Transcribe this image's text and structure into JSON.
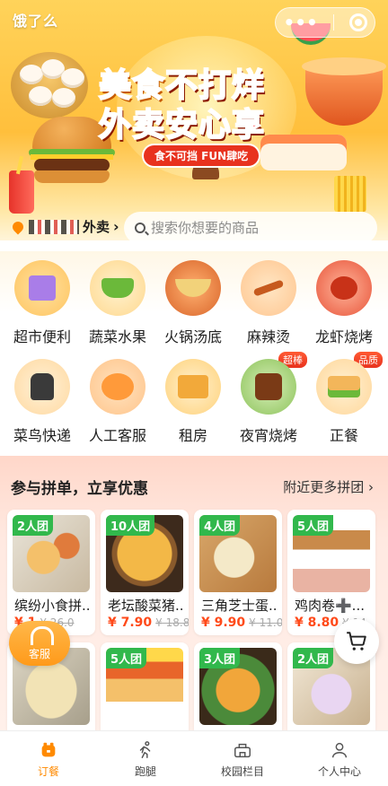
{
  "app": {
    "name": "饿了么"
  },
  "banner": {
    "headline_black": "美食",
    "headline_red": "不打烊",
    "headline_line2": "外卖安心享",
    "slogan": "食不可挡 FUN肆吃"
  },
  "location": {
    "label": "外卖"
  },
  "search": {
    "placeholder": "搜索你想要的商品"
  },
  "categories": [
    {
      "label": "超市便利",
      "icon": "shopping-bag-icon"
    },
    {
      "label": "蔬菜水果",
      "icon": "vegetable-basket-icon"
    },
    {
      "label": "火锅汤底",
      "icon": "hotpot-icon"
    },
    {
      "label": "麻辣烫",
      "icon": "skewer-icon"
    },
    {
      "label": "龙虾烧烤",
      "icon": "lobster-icon"
    },
    {
      "label": "菜鸟快递",
      "icon": "courier-icon"
    },
    {
      "label": "人工客服",
      "icon": "peach-chat-icon"
    },
    {
      "label": "租房",
      "icon": "house-box-icon"
    },
    {
      "label": "夜宵烧烤",
      "icon": "night-snack-icon",
      "badge": "超棒"
    },
    {
      "label": "正餐",
      "icon": "sandwich-icon",
      "badge": "品质"
    }
  ],
  "group_buy": {
    "title": "参与拼单，立享优惠",
    "more": "附近更多拼团",
    "items": [
      {
        "tag": "2人团",
        "name": "缤纷小食拼...",
        "price": "¥ 1",
        "orig": "¥ 26.0"
      },
      {
        "tag": "10人团",
        "name": "老坛酸菜猪...",
        "price": "¥ 7.90",
        "orig": "¥ 18.80"
      },
      {
        "tag": "4人团",
        "name": "三角芝士蛋...",
        "price": "¥ 9.90",
        "orig": "¥ 11.00"
      },
      {
        "tag": "5人团",
        "name": "鸡肉卷➕...",
        "price": "¥ 8.80",
        "orig": "¥ 14"
      },
      {
        "tag": "",
        "name": "",
        "price": "",
        "orig": ""
      },
      {
        "tag": "5人团",
        "name": "",
        "price": "",
        "orig": ""
      },
      {
        "tag": "3人团",
        "name": "",
        "price": "",
        "orig": ""
      },
      {
        "tag": "2人团",
        "name": "",
        "price": "",
        "orig": ""
      }
    ]
  },
  "floating": {
    "service": "客服"
  },
  "tabbar": [
    {
      "label": "订餐",
      "icon": "order-food-icon",
      "active": true
    },
    {
      "label": "跑腿",
      "icon": "runner-icon",
      "active": false
    },
    {
      "label": "校园栏目",
      "icon": "campus-icon",
      "active": false
    },
    {
      "label": "个人中心",
      "icon": "user-icon",
      "active": false
    }
  ],
  "colors": {
    "accent": "#ff8a00",
    "price": "#ff4a1a",
    "group_tag": "#31b84c",
    "banner": "#ffbf3c"
  }
}
